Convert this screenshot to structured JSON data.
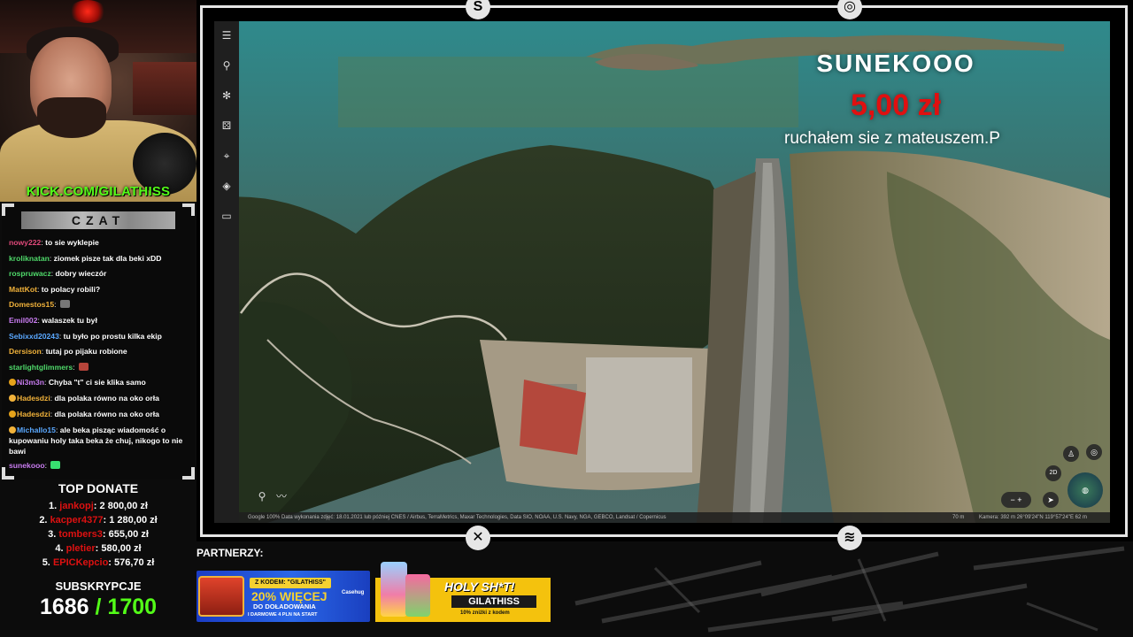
{
  "stream": {
    "channel_url": "KICK.COM/GILATHISS",
    "chat_title": "CZAT",
    "partners_label": "PARTNERZY:"
  },
  "chat": [
    {
      "user": "nowy222",
      "text": "to sie wyklepie",
      "color": "#e0497a"
    },
    {
      "user": "kroliknatan",
      "text": "ziomek pisze tak dla beki xDD",
      "color": "#4fd96a"
    },
    {
      "user": "rospruwacz",
      "text": "dobry wieczór",
      "color": "#4fd96a"
    },
    {
      "user": "MattKot",
      "text": "to polacy robili?",
      "color": "#f1b23a"
    },
    {
      "user": "Domestos15",
      "text": "",
      "color": "#f1b23a"
    },
    {
      "user": "Emil002",
      "text": "walaszek tu był",
      "color": "#c87cf0"
    },
    {
      "user": "Sebixxd20243",
      "text": "tu było po prostu kilka ekip",
      "color": "#5aa8ff"
    },
    {
      "user": "Dersison",
      "text": "tutaj po pijaku robione",
      "color": "#f1b23a"
    },
    {
      "user": "starlightglimmers",
      "text": "",
      "color": "#4fd96a"
    },
    {
      "user": "Ni3m3n",
      "text": "Chyba \"t\" ci sie klika samo",
      "color": "#c87cf0"
    },
    {
      "user": "Hadesdzi",
      "text": "dla polaka równo na oko orła",
      "color": "#f1b23a"
    },
    {
      "user": "Hadesdzi",
      "text": "dla polaka równo na oko orła",
      "color": "#f1b23a"
    },
    {
      "user": "Michallo15",
      "text": "ale beka pisząc wiadomość o kupowaniu holy taka beka że chuj, nikogo to nie bawi",
      "color": "#5aa8ff"
    },
    {
      "user": "sunekooo",
      "text": "",
      "color": "#c87cf0"
    }
  ],
  "top_donate": {
    "title": "TOP DONATE",
    "entries": [
      {
        "rank": "1.",
        "name": "jankopj",
        "amount": "2 800,00 zł"
      },
      {
        "rank": "2.",
        "name": "kacper4377",
        "amount": "1 280,00 zł"
      },
      {
        "rank": "3.",
        "name": "tombers3",
        "amount": "655,00 zł"
      },
      {
        "rank": "4.",
        "name": "pletier",
        "amount": "580,00 zł"
      },
      {
        "rank": "5.",
        "name": "EPICKepcio",
        "amount": "576,70 zł"
      }
    ]
  },
  "subs": {
    "title": "SUBSKRYPCJE",
    "current": "1686",
    "goal": "/ 1700"
  },
  "alert": {
    "user": "SUNEKOOO",
    "amount": "5,00 zł",
    "message": "ruchałem sie z mateuszem.P"
  },
  "map": {
    "attribution": "Google   100%   Data wykonania zdjęć: 18.01.2021 lub później   CNES / Airbus, TerraMetrics, Maxar Technologies, Data SIO, NOAA, U.S. Navy, NGA, GEBCO, Landsat / Copernicus",
    "scale": "70 m",
    "camera": "Kamera: 392 m   26°09'24\"N 119°57'24\"E   62 m",
    "view_mode": "2D"
  },
  "ads": {
    "casehug": {
      "code": "Z KODEM: \"GILATHISS\"",
      "big": "20% WIĘCEJ",
      "line2": "DO DOŁADOWANIA",
      "line3": "I DARMOWE 4 PLN NA START",
      "brand": "Casehug"
    },
    "holy": {
      "title": "HOLY SH*T!",
      "code": "GILATHISS",
      "sub": "10% zniżki z kodem"
    }
  },
  "colors": {
    "kick_green": "#53fc18",
    "alert_red": "#e01010",
    "donor_red": "#dd1111"
  }
}
